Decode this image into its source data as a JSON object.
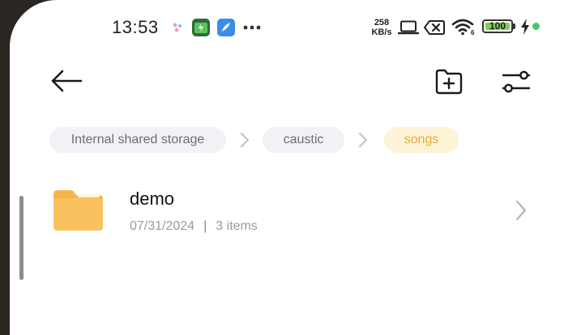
{
  "status_bar": {
    "time": "13:53",
    "net_speed_value": "258",
    "net_speed_unit": "KB/s",
    "battery_level": "100",
    "icons": [
      "assistant-dots-icon",
      "battery-saver-app-icon",
      "notes-app-icon",
      "more-dots-icon",
      "laptop-icon",
      "sim-x-icon",
      "wifi-6-icon",
      "battery-icon",
      "charging-icon",
      "green-dot-indicator"
    ]
  },
  "toolbar": {
    "icons": [
      "back-arrow-icon",
      "new-folder-icon",
      "filter-sliders-icon"
    ]
  },
  "breadcrumb": {
    "items": [
      {
        "label": "Internal shared storage"
      },
      {
        "label": "caustic"
      },
      {
        "label": "songs"
      }
    ]
  },
  "files": [
    {
      "name": "demo",
      "date": "07/31/2024",
      "separator": "|",
      "count": "3 items"
    }
  ],
  "colors": {
    "folder": "#f5b54a",
    "active_chip_bg": "#fdf3d6",
    "active_chip_text": "#e7ad3a",
    "chip_bg": "#f1f2f5"
  }
}
